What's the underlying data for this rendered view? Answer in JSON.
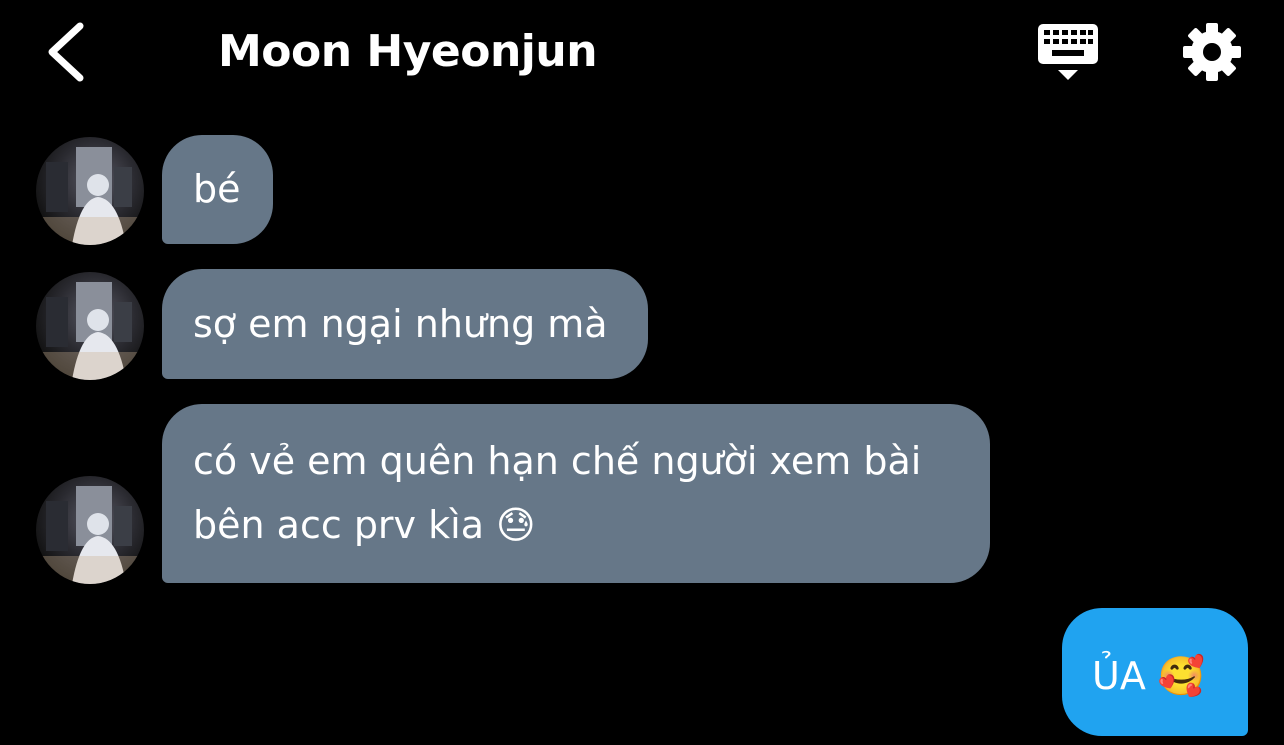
{
  "header": {
    "title": "Moon Hyeonjun",
    "back_icon": "chevron-left-icon",
    "keyboard_icon": "keyboard-icon",
    "settings_icon": "gear-icon"
  },
  "messages": [
    {
      "sender": "them",
      "lines": [
        "bé"
      ]
    },
    {
      "sender": "them",
      "lines": [
        "sợ em ngại nhưng mà"
      ]
    },
    {
      "sender": "them",
      "lines": [
        "có vẻ em quên hạn chế người xem bài",
        "bên acc prv kìa 😓"
      ]
    },
    {
      "sender": "me",
      "lines": [
        "ỦA 🥰"
      ]
    }
  ],
  "colors": {
    "background": "#000000",
    "incoming_bubble": "#667788",
    "outgoing_bubble": "#20a3f0",
    "text": "#ffffff"
  }
}
